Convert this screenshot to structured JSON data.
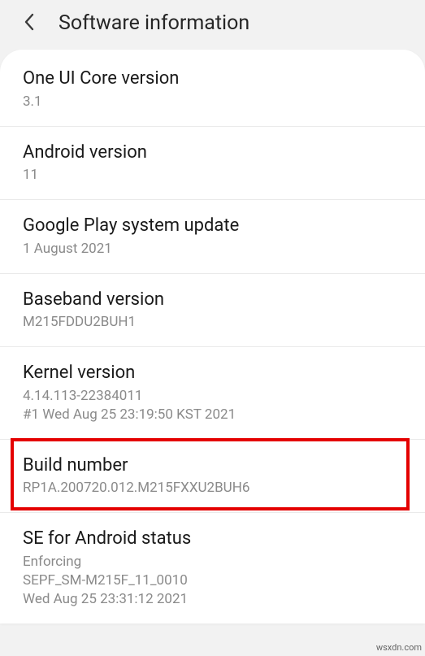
{
  "header": {
    "title": "Software information"
  },
  "items": [
    {
      "label": "One UI Core version",
      "value": "3.1"
    },
    {
      "label": "Android version",
      "value": "11"
    },
    {
      "label": "Google Play system update",
      "value": "1 August 2021"
    },
    {
      "label": "Baseband version",
      "value": "M215FDDU2BUH1"
    },
    {
      "label": "Kernel version",
      "value": "4.14.113-22384011\n#1 Wed Aug 25 23:19:50 KST 2021"
    },
    {
      "label": "Build number",
      "value": "RP1A.200720.012.M215FXXU2BUH6",
      "highlighted": true
    },
    {
      "label": "SE for Android status",
      "value": "Enforcing\nSEPF_SM-M215F_11_0010\nWed Aug 25 23:31:12 2021"
    }
  ],
  "watermark": "wsxdn.com"
}
